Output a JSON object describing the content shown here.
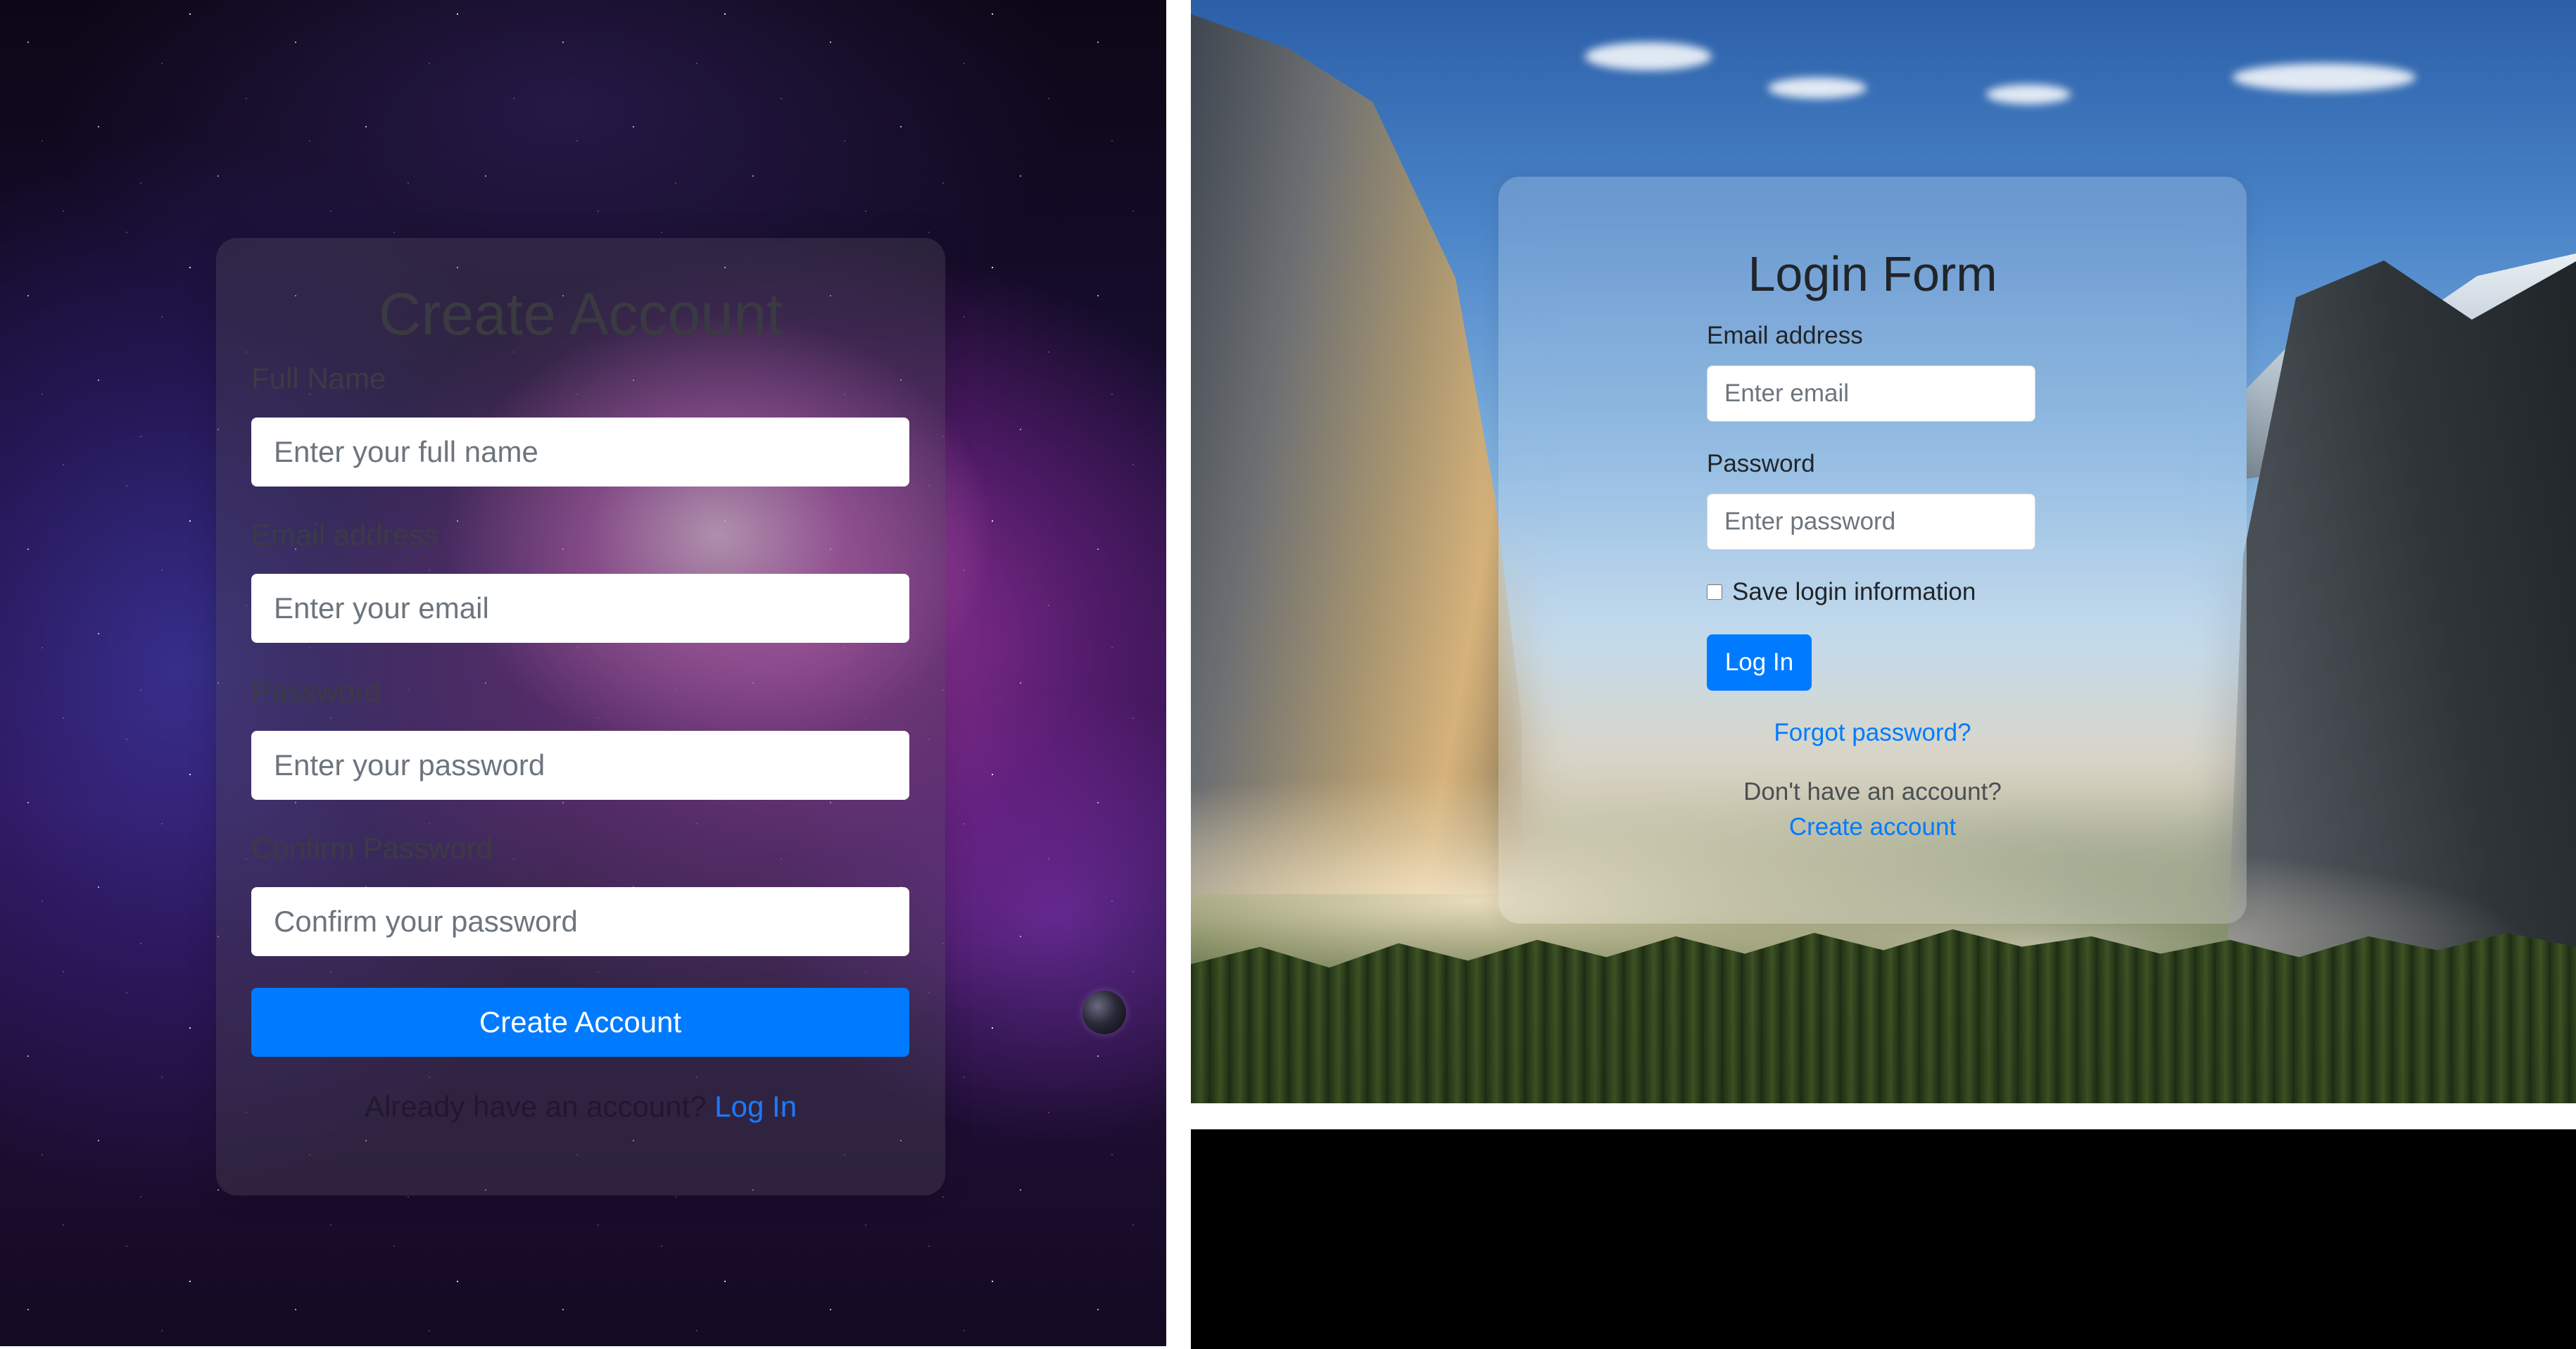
{
  "signup": {
    "title": "Create Account",
    "full_name": {
      "label": "Full Name",
      "placeholder": "Enter your full name"
    },
    "email": {
      "label": "Email address",
      "placeholder": "Enter your email"
    },
    "password": {
      "label": "Password",
      "placeholder": "Enter your password"
    },
    "confirm_password": {
      "label": "Confirm Password",
      "placeholder": "Confirm your password"
    },
    "submit_label": "Create Account",
    "footer_text": "Already have an account?",
    "footer_link": "Log In"
  },
  "login": {
    "title": "Login Form",
    "email": {
      "label": "Email address",
      "placeholder": "Enter email"
    },
    "password": {
      "label": "Password",
      "placeholder": "Enter password"
    },
    "remember_label": "Save login information",
    "remember_checked": false,
    "submit_label": "Log In",
    "forgot_link": "Forgot password?",
    "no_account_text": "Don't have an account?",
    "create_link": "Create account"
  },
  "colors": {
    "primary": "#007bff",
    "divider": "#ffffff",
    "bottom_strip": "#000000"
  }
}
